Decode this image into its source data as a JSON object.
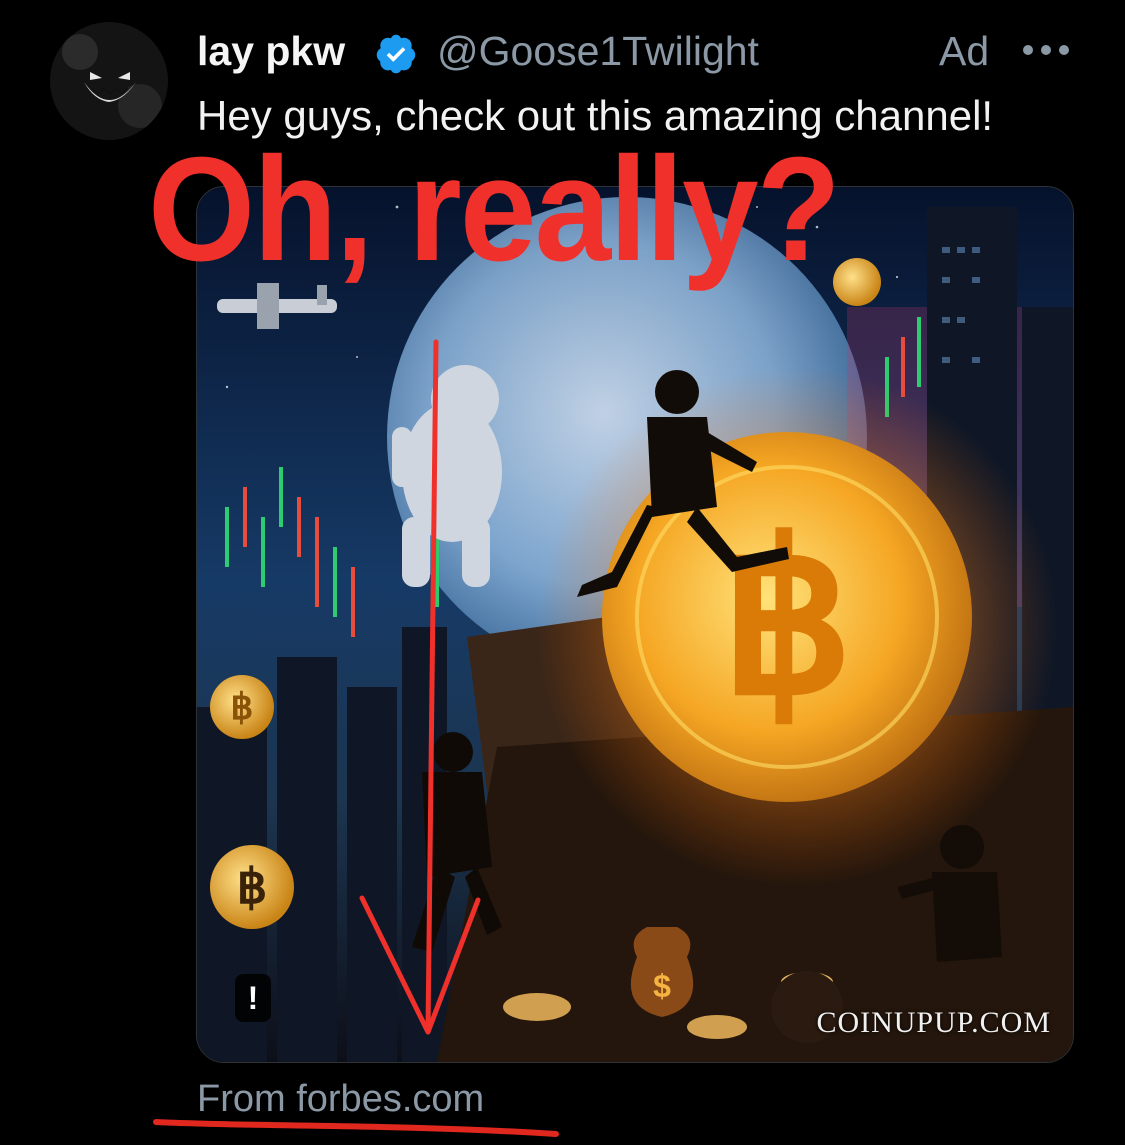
{
  "tweet": {
    "display_name": "lay pkw",
    "handle": "@Goose1Twilight",
    "ad_label": "Ad",
    "text": "Hey guys, check out this amazing channel!",
    "source": "From forbes.com"
  },
  "media": {
    "watermark": "COINUPUP.COM",
    "alt_badge": "!"
  },
  "overlay": {
    "caption": "Oh, really?",
    "color": "#f0302b"
  },
  "colors": {
    "verified": "#1d9bf0",
    "muted": "#8b98a5",
    "background": "#000000"
  },
  "icons": [
    "verified-badge-icon",
    "more-options-icon",
    "down-arrow-annotation"
  ]
}
